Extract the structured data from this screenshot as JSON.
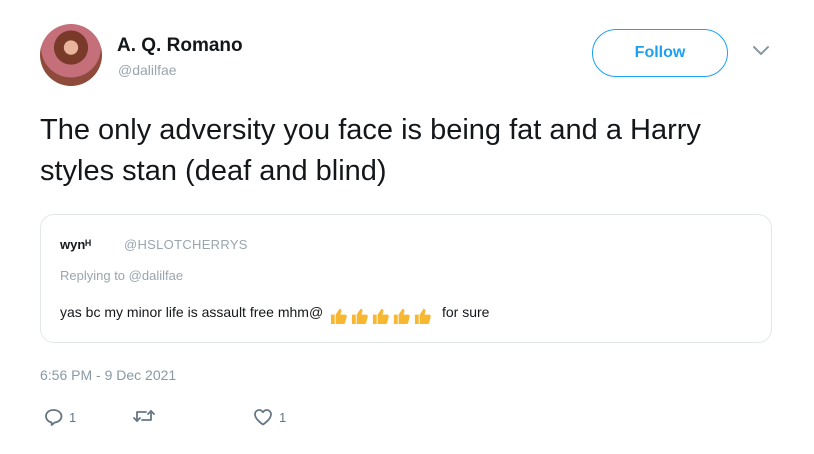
{
  "user": {
    "display_name": "A. Q. Romano",
    "handle": "@dalilfae"
  },
  "follow_label": "Follow",
  "tweet": {
    "text": "The only adversity you face is being fat and a Harry styles stan (deaf and blind)",
    "timestamp": "6:56 PM - 9 Dec 2021"
  },
  "quoted": {
    "name": "wynᴴ",
    "handle": "@HSLOTCHERRYS",
    "reply_prefix": "Replying to ",
    "reply_to": "@dalilfae",
    "text": "yas bc my minor life is assault free mhm",
    "at_symbol": "@",
    "emoji": [
      "thumbs-up",
      "thumbs-up",
      "thumbs-up",
      "thumbs-up",
      "thumbs-up"
    ],
    "suffix": "for sure"
  },
  "actions": {
    "reply_count": "1",
    "like_count": "1"
  },
  "colors": {
    "accent": "#1da1f2",
    "muted": "#9aa5ae",
    "text": "#14171a",
    "border": "#e1e8ed",
    "emoji": "#f7b731"
  }
}
